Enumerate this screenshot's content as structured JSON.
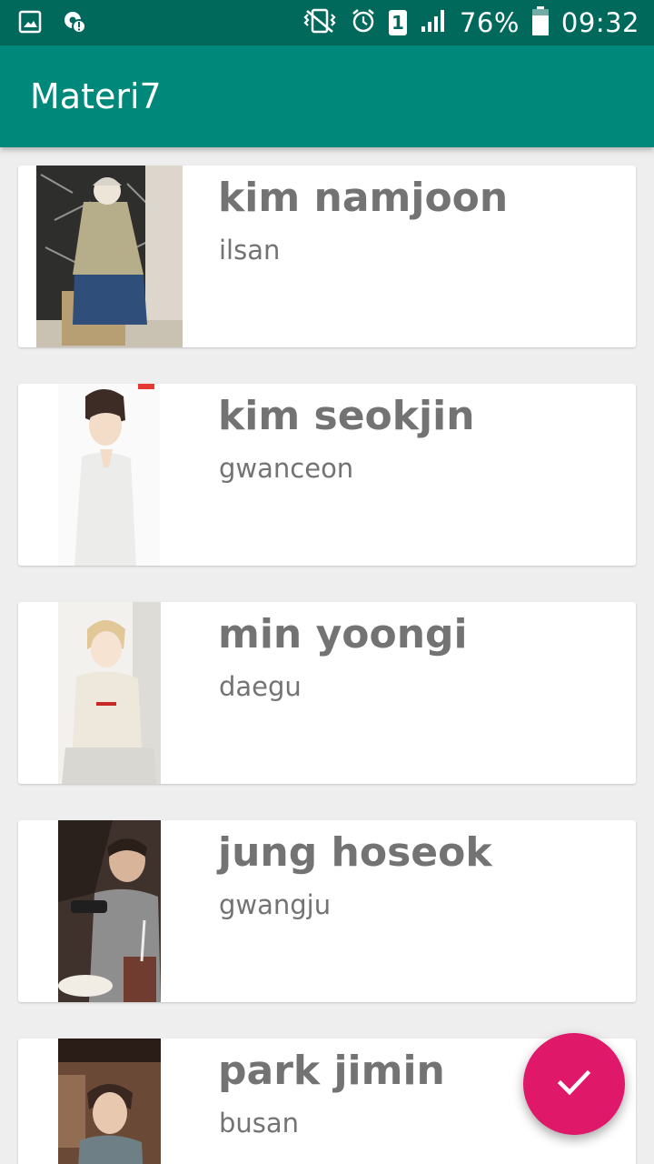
{
  "status_bar": {
    "battery_percent": "76%",
    "time": "09:32",
    "sim_slot": "1",
    "icons": [
      "image-notification-icon",
      "settings-alert-icon",
      "vibrate-icon",
      "alarm-icon",
      "sim-icon",
      "signal-icon",
      "battery-icon"
    ]
  },
  "app_bar": {
    "title": "Materi7"
  },
  "people": [
    {
      "name": "kim namjoon",
      "city": "ilsan"
    },
    {
      "name": "kim seokjin",
      "city": "gwanceon"
    },
    {
      "name": "min yoongi",
      "city": "daegu"
    },
    {
      "name": "jung hoseok",
      "city": "gwangju"
    },
    {
      "name": "park jimin",
      "city": "busan"
    }
  ],
  "fab": {
    "icon": "check-icon"
  },
  "colors": {
    "status_bar": "#00695c",
    "app_bar": "#00897b",
    "fab": "#e0186a",
    "text": "#737373",
    "background": "#eeeeee"
  }
}
